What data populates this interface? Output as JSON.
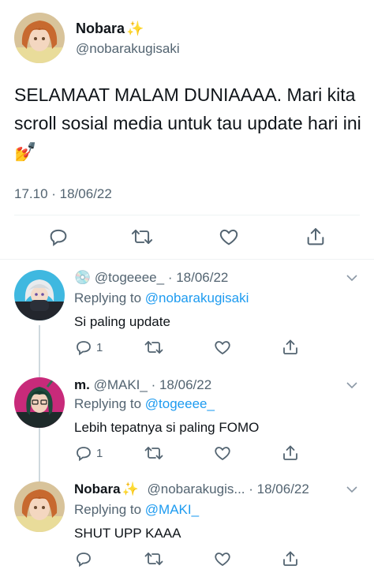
{
  "main_tweet": {
    "name": "Nobara",
    "name_emoji": "✨",
    "handle": "@nobarakugisaki",
    "text": "SELAMAAT MALAM DUNIAAAA. Mari kita scroll sosial media untuk tau update hari ini💅",
    "time": "17.10 · 18/06/22",
    "avatar_icon": "nobara-avatar-icon"
  },
  "replies": [
    {
      "name": "",
      "name_emoji": "💿",
      "handle": "@togeeee_",
      "date": "· 18/06/22",
      "replying_prefix": "Replying to",
      "replying_to": "@nobarakugisaki",
      "text": "Si paling update",
      "reply_count": "1",
      "avatar_icon": "toge-avatar-icon"
    },
    {
      "name": "m.",
      "name_emoji": "",
      "handle": "@MAKI_",
      "date": "· 18/06/22",
      "replying_prefix": "Replying to",
      "replying_to": "@togeeee_",
      "text": "Lebih tepatnya si paling FOMO",
      "reply_count": "1",
      "avatar_icon": "maki-avatar-icon"
    },
    {
      "name": "Nobara",
      "name_emoji": "✨",
      "handle": "@nobarakugis...",
      "date": "· 18/06/22",
      "replying_prefix": "Replying to",
      "replying_to": "@MAKI_",
      "text": "SHUT UPP KAAA",
      "reply_count": "",
      "avatar_icon": "nobara-avatar-icon"
    }
  ],
  "colors": {
    "text": "#0f1419",
    "secondary": "#536471",
    "accent": "#1d9bf0",
    "divider": "#eff3f4",
    "thread_line": "#cfd9de"
  }
}
